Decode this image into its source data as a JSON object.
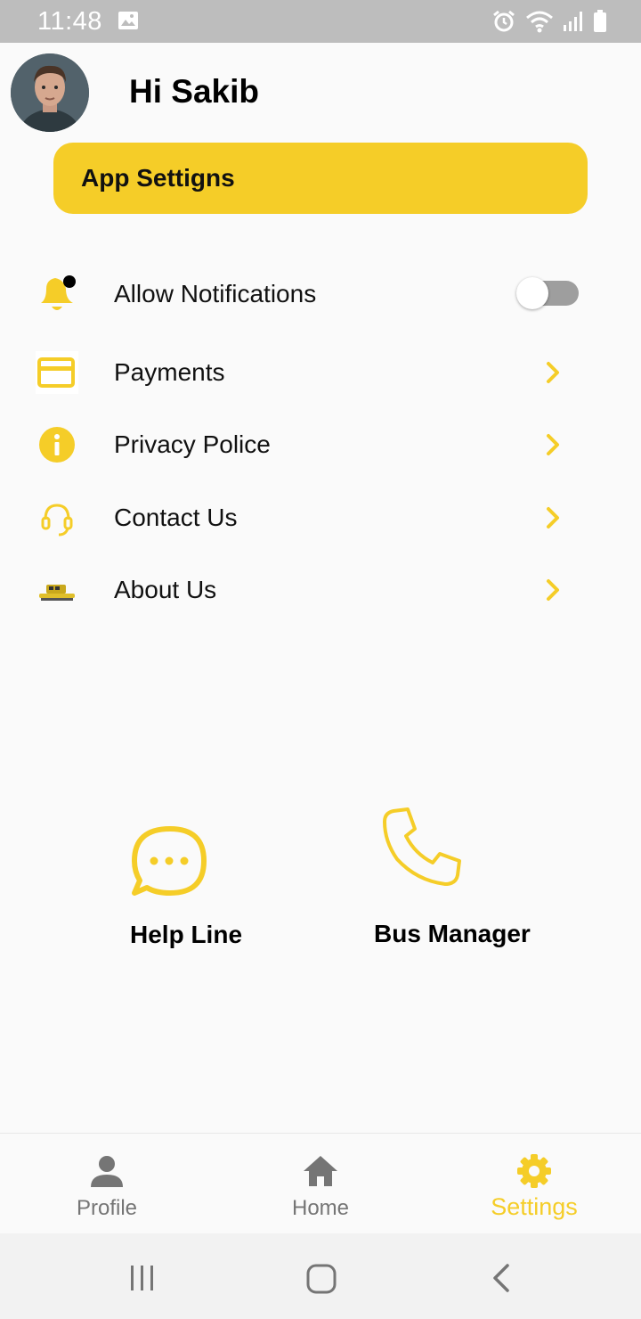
{
  "status_bar": {
    "time": "11:48"
  },
  "header": {
    "greeting": "Hi Sakib"
  },
  "banner": {
    "title": "App Settigns"
  },
  "menu": {
    "notifications": {
      "label": "Allow Notifications",
      "enabled": false
    },
    "payments": {
      "label": "Payments"
    },
    "privacy": {
      "label": "Privacy Police"
    },
    "contact": {
      "label": "Contact Us"
    },
    "about": {
      "label": "About Us"
    }
  },
  "quick_actions": {
    "help_line": {
      "label": "Help Line",
      "icon": "chat-bubble-icon"
    },
    "bus_manager": {
      "label": "Bus Manager",
      "icon": "phone-icon"
    }
  },
  "bottom_nav": {
    "profile": {
      "label": "Profile"
    },
    "home": {
      "label": "Home"
    },
    "settings": {
      "label": "Settings",
      "active": true
    }
  },
  "colors": {
    "accent": "#f5cd28",
    "inactive": "#757575"
  }
}
